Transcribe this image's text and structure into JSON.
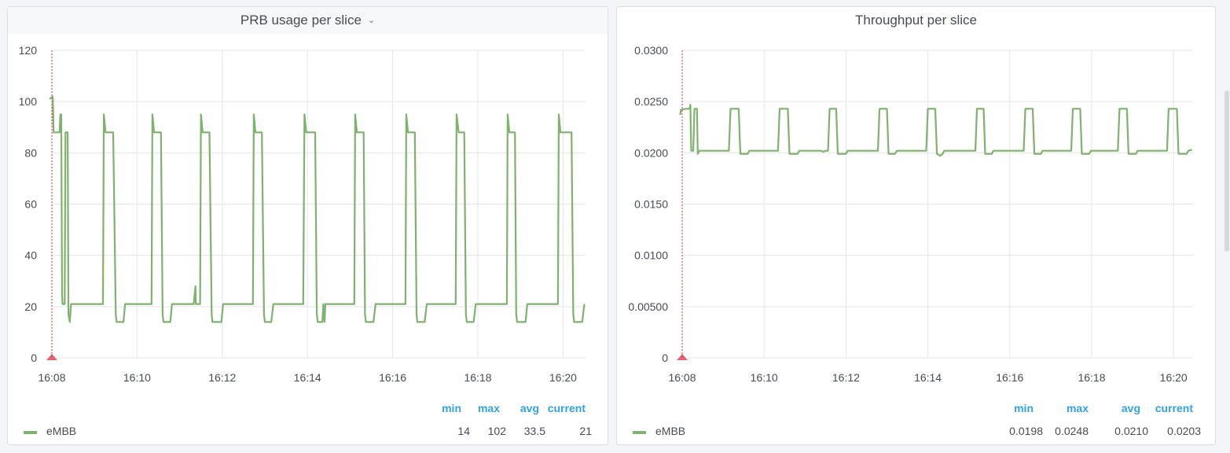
{
  "panels": [
    {
      "title": "PRB usage per slice",
      "menu_icon": "chevron-down-icon",
      "legend": {
        "headers": {
          "min": "min",
          "max": "max",
          "avg": "avg",
          "current": "current"
        },
        "series": [
          {
            "name": "eMBB",
            "min": "14",
            "max": "102",
            "avg": "33.5",
            "current": "21"
          }
        ]
      },
      "chart_data": {
        "type": "line",
        "title": "PRB usage per slice",
        "xlabel": "",
        "ylabel": "",
        "x_unit": "time (minutes)",
        "xlim": [
          0,
          12.65
        ],
        "ylim": [
          0,
          120
        ],
        "y_ticks": [
          "0",
          "20",
          "40",
          "60",
          "80",
          "100",
          "120"
        ],
        "y_tick_values": [
          0,
          20,
          40,
          60,
          80,
          100,
          120
        ],
        "x_ticks": [
          "16:08",
          "16:10",
          "16:12",
          "16:14",
          "16:16",
          "16:18",
          "16:20"
        ],
        "x_tick_values": [
          0,
          2,
          4,
          6,
          8,
          10,
          12
        ],
        "annotation": {
          "type": "dashed-vertical-marker",
          "x": 0,
          "color": "#e02f44"
        },
        "grid": true,
        "series": [
          {
            "name": "eMBB",
            "color": "#7eb26d",
            "points": [
              [
                -0.05,
                101
              ],
              [
                0.02,
                102
              ],
              [
                0.04,
                88
              ],
              [
                0.12,
                88
              ],
              [
                0.18,
                88
              ],
              [
                0.2,
                95
              ],
              [
                0.22,
                95
              ],
              [
                0.24,
                24
              ],
              [
                0.25,
                21
              ],
              [
                0.3,
                21
              ],
              [
                0.32,
                88
              ],
              [
                0.37,
                88
              ],
              [
                0.39,
                17
              ],
              [
                0.42,
                14
              ],
              [
                0.45,
                21
              ],
              [
                0.58,
                21
              ],
              [
                1.2,
                21
              ],
              [
                1.22,
                95
              ],
              [
                1.26,
                88
              ],
              [
                1.44,
                88
              ],
              [
                1.5,
                17
              ],
              [
                1.52,
                14
              ],
              [
                1.68,
                14
              ],
              [
                1.72,
                21
              ],
              [
                1.9,
                21
              ],
              [
                2.34,
                21
              ],
              [
                2.36,
                95
              ],
              [
                2.4,
                88
              ],
              [
                2.56,
                88
              ],
              [
                2.6,
                17
              ],
              [
                2.62,
                14
              ],
              [
                2.78,
                14
              ],
              [
                2.82,
                21
              ],
              [
                3.3,
                21
              ],
              [
                3.33,
                21
              ],
              [
                3.37,
                28
              ],
              [
                3.38,
                21
              ],
              [
                3.48,
                21
              ],
              [
                3.5,
                95
              ],
              [
                3.54,
                88
              ],
              [
                3.7,
                88
              ],
              [
                3.75,
                17
              ],
              [
                3.77,
                14
              ],
              [
                3.98,
                14
              ],
              [
                4.02,
                21
              ],
              [
                4.72,
                21
              ],
              [
                4.74,
                95
              ],
              [
                4.78,
                88
              ],
              [
                4.93,
                88
              ],
              [
                4.98,
                17
              ],
              [
                5.0,
                14
              ],
              [
                5.15,
                14
              ],
              [
                5.2,
                21
              ],
              [
                5.9,
                21
              ],
              [
                5.93,
                95
              ],
              [
                5.97,
                88
              ],
              [
                6.18,
                88
              ],
              [
                6.22,
                17
              ],
              [
                6.24,
                14
              ],
              [
                6.35,
                14
              ],
              [
                6.37,
                21
              ],
              [
                6.4,
                14
              ],
              [
                6.42,
                21
              ],
              [
                7.1,
                21
              ],
              [
                7.12,
                95
              ],
              [
                7.16,
                88
              ],
              [
                7.32,
                88
              ],
              [
                7.35,
                17
              ],
              [
                7.37,
                14
              ],
              [
                7.55,
                14
              ],
              [
                7.6,
                21
              ],
              [
                8.3,
                21
              ],
              [
                8.32,
                95
              ],
              [
                8.36,
                88
              ],
              [
                8.52,
                88
              ],
              [
                8.56,
                17
              ],
              [
                8.58,
                14
              ],
              [
                8.75,
                14
              ],
              [
                8.8,
                21
              ],
              [
                9.48,
                21
              ],
              [
                9.5,
                95
              ],
              [
                9.55,
                88
              ],
              [
                9.68,
                88
              ],
              [
                9.72,
                17
              ],
              [
                9.74,
                14
              ],
              [
                9.9,
                14
              ],
              [
                9.95,
                21
              ],
              [
                10.68,
                21
              ],
              [
                10.7,
                95
              ],
              [
                10.74,
                88
              ],
              [
                10.87,
                88
              ],
              [
                10.9,
                17
              ],
              [
                10.92,
                14
              ],
              [
                11.12,
                14
              ],
              [
                11.16,
                21
              ],
              [
                11.88,
                21
              ],
              [
                11.9,
                95
              ],
              [
                11.94,
                88
              ],
              [
                12.2,
                88
              ],
              [
                12.24,
                17
              ],
              [
                12.26,
                14
              ],
              [
                12.45,
                14
              ],
              [
                12.5,
                21
              ]
            ]
          }
        ]
      }
    },
    {
      "title": "Throughput per slice",
      "legend": {
        "headers": {
          "min": "min",
          "max": "max",
          "avg": "avg",
          "current": "current"
        },
        "series": [
          {
            "name": "eMBB",
            "min": "0.0198",
            "max": "0.0248",
            "avg": "0.0210",
            "current": "0.0203"
          }
        ]
      },
      "chart_data": {
        "type": "line",
        "title": "Throughput per slice",
        "xlabel": "",
        "ylabel": "",
        "x_unit": "time (minutes)",
        "xlim": [
          0,
          12.65
        ],
        "ylim": [
          0,
          0.03
        ],
        "y_ticks": [
          "0",
          "0.00500",
          "0.0100",
          "0.0150",
          "0.0200",
          "0.0250",
          "0.0300"
        ],
        "y_tick_values": [
          0,
          0.005,
          0.01,
          0.015,
          0.02,
          0.025,
          0.03
        ],
        "x_ticks": [
          "16:08",
          "16:10",
          "16:12",
          "16:14",
          "16:16",
          "16:18",
          "16:20"
        ],
        "x_tick_values": [
          0,
          2,
          4,
          6,
          8,
          10,
          12
        ],
        "annotation": {
          "type": "dashed-vertical-marker",
          "x": 0,
          "color": "#e02f44"
        },
        "grid": true,
        "series": [
          {
            "name": "eMBB",
            "color": "#7eb26d",
            "points": [
              [
                -0.05,
                0.0237
              ],
              [
                -0.03,
                0.0242
              ],
              [
                0.1,
                0.0243
              ],
              [
                0.18,
                0.0243
              ],
              [
                0.2,
                0.0247
              ],
              [
                0.22,
                0.0202
              ],
              [
                0.27,
                0.0202
              ],
              [
                0.3,
                0.0243
              ],
              [
                0.36,
                0.0243
              ],
              [
                0.38,
                0.0199
              ],
              [
                0.42,
                0.0202
              ],
              [
                1.14,
                0.0202
              ],
              [
                1.18,
                0.0243
              ],
              [
                1.38,
                0.0243
              ],
              [
                1.42,
                0.0199
              ],
              [
                1.6,
                0.0199
              ],
              [
                1.64,
                0.0202
              ],
              [
                2.34,
                0.0202
              ],
              [
                2.38,
                0.0243
              ],
              [
                2.58,
                0.0243
              ],
              [
                2.62,
                0.0199
              ],
              [
                2.82,
                0.0199
              ],
              [
                2.86,
                0.0202
              ],
              [
                3.4,
                0.0202
              ],
              [
                3.45,
                0.0201
              ],
              [
                3.5,
                0.0202
              ],
              [
                3.56,
                0.0202
              ],
              [
                3.6,
                0.0243
              ],
              [
                3.76,
                0.0243
              ],
              [
                3.8,
                0.0199
              ],
              [
                4.0,
                0.0199
              ],
              [
                4.04,
                0.0202
              ],
              [
                4.78,
                0.0202
              ],
              [
                4.82,
                0.0243
              ],
              [
                5.0,
                0.0243
              ],
              [
                5.04,
                0.0199
              ],
              [
                5.2,
                0.0199
              ],
              [
                5.24,
                0.0202
              ],
              [
                5.96,
                0.0202
              ],
              [
                6.0,
                0.0243
              ],
              [
                6.18,
                0.0243
              ],
              [
                6.22,
                0.0199
              ],
              [
                6.3,
                0.0197
              ],
              [
                6.36,
                0.0199
              ],
              [
                6.4,
                0.0202
              ],
              [
                7.16,
                0.0202
              ],
              [
                7.2,
                0.0243
              ],
              [
                7.36,
                0.0243
              ],
              [
                7.4,
                0.0199
              ],
              [
                7.56,
                0.0199
              ],
              [
                7.6,
                0.0202
              ],
              [
                8.34,
                0.0202
              ],
              [
                8.38,
                0.0243
              ],
              [
                8.56,
                0.0243
              ],
              [
                8.6,
                0.0199
              ],
              [
                8.76,
                0.0199
              ],
              [
                8.8,
                0.0202
              ],
              [
                9.5,
                0.0202
              ],
              [
                9.54,
                0.0243
              ],
              [
                9.72,
                0.0243
              ],
              [
                9.76,
                0.0199
              ],
              [
                9.94,
                0.0199
              ],
              [
                9.98,
                0.0202
              ],
              [
                10.64,
                0.0202
              ],
              [
                10.68,
                0.0243
              ],
              [
                10.86,
                0.0243
              ],
              [
                10.9,
                0.0199
              ],
              [
                11.08,
                0.0199
              ],
              [
                11.12,
                0.0202
              ],
              [
                11.84,
                0.0202
              ],
              [
                11.88,
                0.0243
              ],
              [
                12.08,
                0.0243
              ],
              [
                12.12,
                0.0199
              ],
              [
                12.32,
                0.0199
              ],
              [
                12.36,
                0.0202
              ],
              [
                12.45,
                0.0203
              ]
            ]
          }
        ]
      }
    }
  ]
}
